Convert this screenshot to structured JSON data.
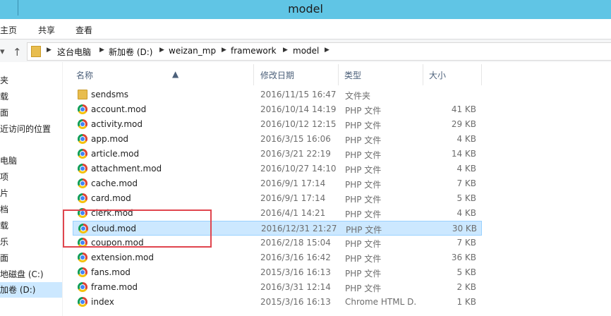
{
  "window": {
    "title": "model"
  },
  "ribbon": {
    "tabs": [
      "主页",
      "共享",
      "查看"
    ]
  },
  "address": {
    "crumbs": [
      "这台电脑",
      "新加卷 (D:)",
      "weizan_mp",
      "framework",
      "model"
    ]
  },
  "nav": {
    "items": [
      "夹",
      "载",
      "面",
      "近访问的位置",
      "电脑",
      "项",
      "片",
      "档",
      "载",
      "乐",
      "面",
      "地磁盘 (C:)",
      "加卷 (D:)"
    ]
  },
  "columns": {
    "name": "名称",
    "modified": "修改日期",
    "type": "类型",
    "size": "大小"
  },
  "files": [
    {
      "name": "sendsms",
      "date": "2016/11/15 16:47",
      "type": "文件夹",
      "size": "",
      "icon": "folder-icon"
    },
    {
      "name": "account.mod",
      "date": "2016/10/14 14:19",
      "type": "PHP 文件",
      "size": "41 KB",
      "icon": "chrome-icon"
    },
    {
      "name": "activity.mod",
      "date": "2016/10/12 12:15",
      "type": "PHP 文件",
      "size": "29 KB",
      "icon": "chrome-icon"
    },
    {
      "name": "app.mod",
      "date": "2016/3/15 16:06",
      "type": "PHP 文件",
      "size": "4 KB",
      "icon": "chrome-icon"
    },
    {
      "name": "article.mod",
      "date": "2016/3/21 22:19",
      "type": "PHP 文件",
      "size": "14 KB",
      "icon": "chrome-icon"
    },
    {
      "name": "attachment.mod",
      "date": "2016/10/27 14:10",
      "type": "PHP 文件",
      "size": "4 KB",
      "icon": "chrome-icon"
    },
    {
      "name": "cache.mod",
      "date": "2016/9/1 17:14",
      "type": "PHP 文件",
      "size": "7 KB",
      "icon": "chrome-icon"
    },
    {
      "name": "card.mod",
      "date": "2016/9/1 17:14",
      "type": "PHP 文件",
      "size": "5 KB",
      "icon": "chrome-icon"
    },
    {
      "name": "clerk.mod",
      "date": "2016/4/1 14:21",
      "type": "PHP 文件",
      "size": "4 KB",
      "icon": "chrome-icon"
    },
    {
      "name": "cloud.mod",
      "date": "2016/12/31 21:27",
      "type": "PHP 文件",
      "size": "30 KB",
      "icon": "chrome-icon",
      "selected": true
    },
    {
      "name": "coupon.mod",
      "date": "2016/2/18 15:04",
      "type": "PHP 文件",
      "size": "7 KB",
      "icon": "chrome-icon"
    },
    {
      "name": "extension.mod",
      "date": "2016/3/16 16:42",
      "type": "PHP 文件",
      "size": "36 KB",
      "icon": "chrome-icon"
    },
    {
      "name": "fans.mod",
      "date": "2015/3/16 16:13",
      "type": "PHP 文件",
      "size": "5 KB",
      "icon": "chrome-icon"
    },
    {
      "name": "frame.mod",
      "date": "2016/3/31 12:14",
      "type": "PHP 文件",
      "size": "2 KB",
      "icon": "chrome-icon"
    },
    {
      "name": "index",
      "date": "2015/3/16 16:13",
      "type": "Chrome HTML D...",
      "size": "1 KB",
      "icon": "chrome-icon"
    }
  ],
  "colors": {
    "titlebar": "#60c5e5",
    "selection": "#cce8ff",
    "highlight_box": "#e0454e"
  }
}
